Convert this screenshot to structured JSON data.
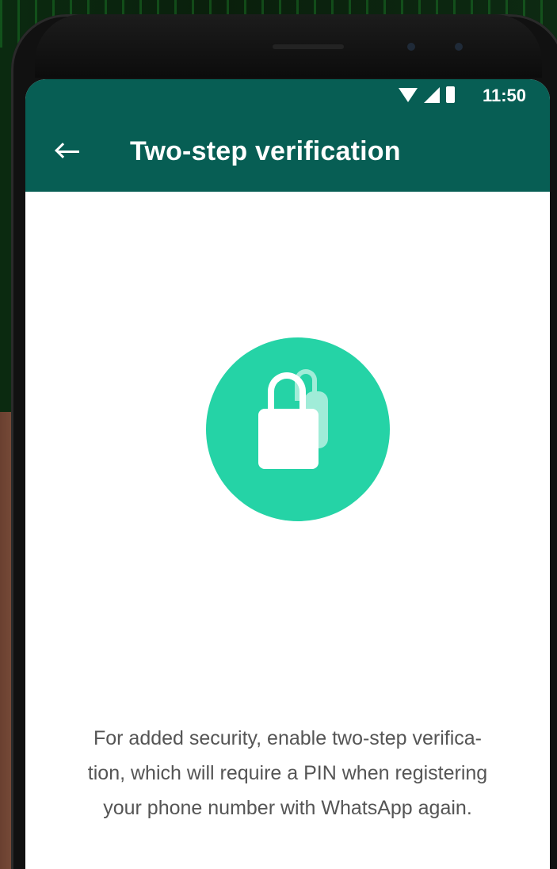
{
  "status_bar": {
    "time": "11:50",
    "icons": [
      "wifi-icon",
      "signal-icon",
      "battery-icon"
    ]
  },
  "app_bar": {
    "title": "Two-step verification",
    "back_icon": "arrow-left-icon"
  },
  "main": {
    "illustration_icon": "lock-icon",
    "description_line1": "For added security, enable two-step verifica-",
    "description_line2": "tion, which will require a PIN when registering",
    "description_line3": "your phone number with WhatsApp again."
  },
  "colors": {
    "toolbar": "#075e54",
    "accent": "#25d3a6",
    "text_secondary": "#555555"
  }
}
